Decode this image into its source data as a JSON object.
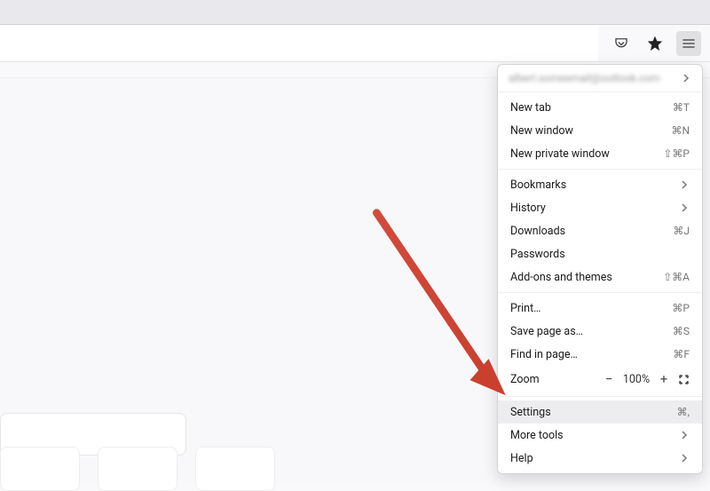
{
  "toolbar": {
    "pocket_icon": "pocket-icon",
    "globe_icon": "globe-icon",
    "menu_icon": "menu-icon"
  },
  "menu": {
    "account": {
      "email_blur": "albert.someemail@outlook.com"
    },
    "sections": [
      {
        "items": [
          {
            "label": "New tab",
            "accel": "⌘T",
            "name": "new-tab"
          },
          {
            "label": "New window",
            "accel": "⌘N",
            "name": "new-window"
          },
          {
            "label": "New private window",
            "accel": "⇧⌘P",
            "name": "new-private-window"
          }
        ]
      },
      {
        "items": [
          {
            "label": "Bookmarks",
            "chevron": true,
            "name": "bookmarks"
          },
          {
            "label": "History",
            "chevron": true,
            "name": "history"
          },
          {
            "label": "Downloads",
            "accel": "⌘J",
            "name": "downloads"
          },
          {
            "label": "Passwords",
            "name": "passwords"
          },
          {
            "label": "Add-ons and themes",
            "accel": "⇧⌘A",
            "name": "addons-themes"
          }
        ]
      },
      {
        "items": [
          {
            "label": "Print…",
            "accel": "⌘P",
            "name": "print"
          },
          {
            "label": "Save page as…",
            "accel": "⌘S",
            "name": "save-page-as"
          },
          {
            "label": "Find in page…",
            "accel": "⌘F",
            "name": "find-in-page"
          }
        ],
        "zoom": {
          "label": "Zoom",
          "value": "100%"
        }
      },
      {
        "items": [
          {
            "label": "Settings",
            "accel": "⌘,",
            "name": "settings",
            "highlight": true
          },
          {
            "label": "More tools",
            "chevron": true,
            "name": "more-tools"
          },
          {
            "label": "Help",
            "chevron": true,
            "name": "help"
          }
        ]
      }
    ]
  }
}
